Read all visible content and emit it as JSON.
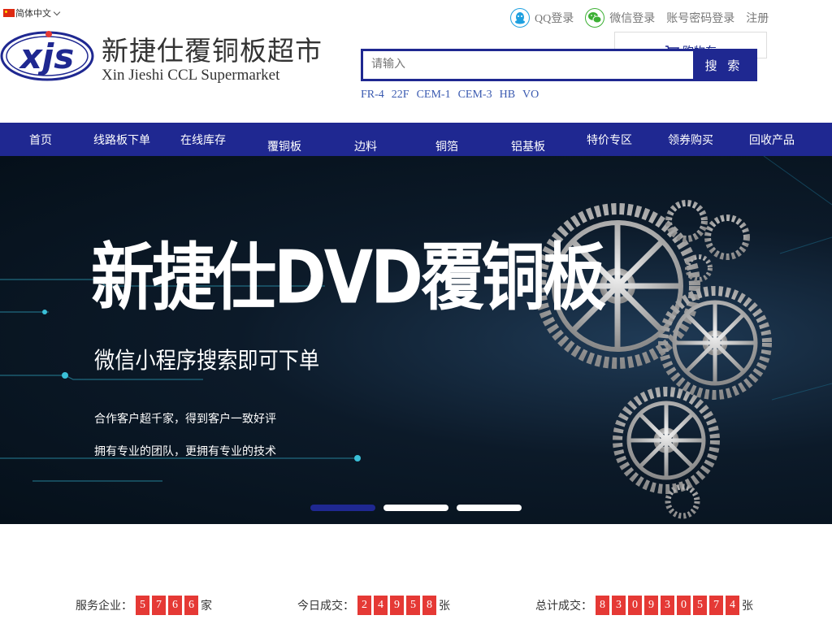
{
  "topbar": {
    "language": "简体中文"
  },
  "brand": {
    "name_cn": "新捷仕覆铜板超市",
    "name_en": "Xin Jieshi CCL Supermarket",
    "logo_text": "XJS"
  },
  "auth": {
    "qq_login": "QQ登录",
    "wechat_login": "微信登录",
    "password_login": "账号密码登录",
    "register": "注册"
  },
  "cart": {
    "label": "购物车"
  },
  "search": {
    "placeholder": "请输入",
    "button": "搜 索"
  },
  "hotwords": [
    "FR-4",
    "22F",
    "CEM-1",
    "CEM-3",
    "HB",
    "VO"
  ],
  "nav": [
    "首页",
    "线路板下单",
    "在线库存",
    "覆铜板",
    "边料",
    "铜箔",
    "铝基板",
    "特价专区",
    "领券购买",
    "回收产品"
  ],
  "banner": {
    "title": "新捷仕DVD覆铜板",
    "subtitle": "微信小程序搜索即可下单",
    "line1": "合作客户超千家，得到客户一致好评",
    "line2": "拥有专业的团队，更拥有专业的技术",
    "slides": 3,
    "active_slide": 1
  },
  "stats": {
    "companies": {
      "label": "服务企业：",
      "digits": [
        "5",
        "7",
        "6",
        "6"
      ],
      "unit": "家"
    },
    "today": {
      "label": "今日成交：",
      "digits": [
        "2",
        "4",
        "9",
        "5",
        "8"
      ],
      "unit": "张"
    },
    "total": {
      "label": "总计成交：",
      "digits": [
        "8",
        "3",
        "0",
        "9",
        "3",
        "0",
        "5",
        "7",
        "4"
      ],
      "unit": "张"
    }
  },
  "colors": {
    "primary": "#1f2891",
    "digit_bg": "#e53935",
    "link": "#3a5ab0"
  }
}
